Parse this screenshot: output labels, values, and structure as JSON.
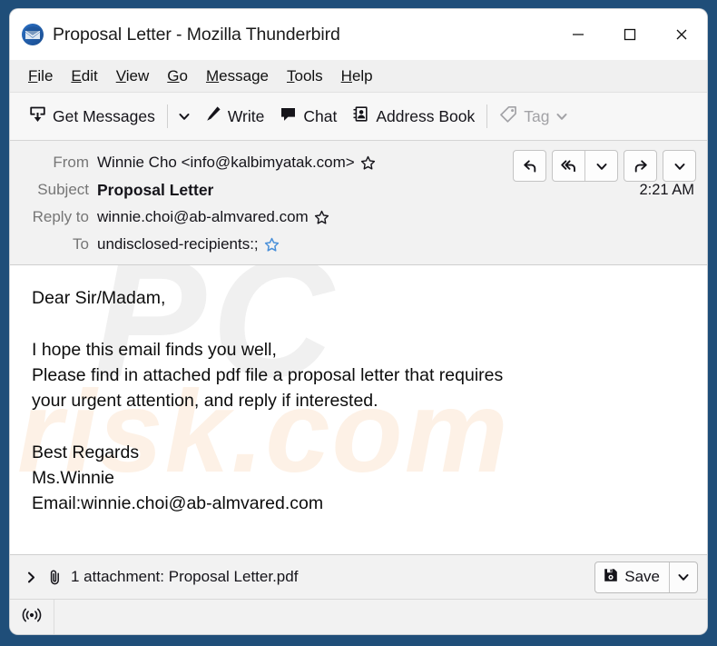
{
  "window": {
    "title": "Proposal Letter - Mozilla Thunderbird",
    "app_icon": "thunderbird-logo-icon",
    "controls": {
      "minimize": "minimize-icon",
      "maximize": "maximize-icon",
      "close": "close-icon"
    }
  },
  "menu": {
    "items": [
      {
        "label": "File",
        "accel": "F"
      },
      {
        "label": "Edit",
        "accel": "E"
      },
      {
        "label": "View",
        "accel": "V"
      },
      {
        "label": "Go",
        "accel": "G"
      },
      {
        "label": "Message",
        "accel": "M"
      },
      {
        "label": "Tools",
        "accel": "T"
      },
      {
        "label": "Help",
        "accel": "H"
      }
    ]
  },
  "toolbar": {
    "get_messages_label": "Get Messages",
    "write_label": "Write",
    "chat_label": "Chat",
    "address_book_label": "Address Book",
    "tag_label": "Tag",
    "tag_disabled": true
  },
  "message_header": {
    "from_label": "From",
    "from_value": "Winnie Cho <info@kalbimyatak.com>",
    "subject_label": "Subject",
    "subject_value": "Proposal Letter",
    "time": "2:21 AM",
    "reply_to_label": "Reply to",
    "reply_to_value": "winnie.choi@ab-almvared.com",
    "to_label": "To",
    "to_value": "undisclosed-recipients:;",
    "actions": {
      "reply": "reply-icon",
      "reply_all": "reply-all-icon",
      "reply_all_more": "chevron-down-icon",
      "forward": "forward-icon",
      "more": "chevron-down-icon"
    },
    "star_colors": {
      "outline": "#15141a",
      "contact": "#4a90d9"
    }
  },
  "body": {
    "text": "Dear Sir/Madam,\n\nI hope this email finds you well,\nPlease find in attached pdf file a proposal letter that requires\nyour urgent attention, and reply if interested.\n\nBest Regards\nMs.Winnie\nEmail:winnie.choi@ab-almvared.com",
    "watermark_top": "PC",
    "watermark_bottom": "risk.com"
  },
  "attachment": {
    "expand_icon": "chevron-right-icon",
    "clip_icon": "paperclip-icon",
    "summary": "1 attachment: Proposal Letter.pdf",
    "save_label": "Save",
    "save_icon": "save-disk-icon",
    "save_caret_icon": "chevron-down-icon"
  },
  "status_bar": {
    "offline_icon": "broadcast-icon",
    "text": ""
  },
  "colors": {
    "frame": "#1f4e79",
    "toolbar_bg": "#f7f7f7",
    "header_bg": "#f2f2f2",
    "body_bg": "#ffffff"
  }
}
